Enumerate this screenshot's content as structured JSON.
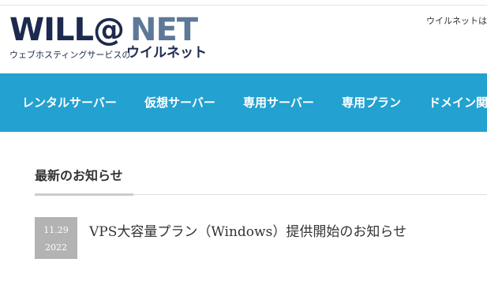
{
  "header": {
    "logo": {
      "part1": "WILL@",
      "part2": "NET",
      "tagline": "ウェブホスティングサービスの",
      "brand": "ウイルネット"
    },
    "note": "ウイルネットは"
  },
  "nav": {
    "items": [
      {
        "label": "レンタルサーバー"
      },
      {
        "label": "仮想サーバー"
      },
      {
        "label": "専用サーバー"
      },
      {
        "label": "専用プラン"
      },
      {
        "label": "ドメイン関"
      }
    ]
  },
  "news": {
    "heading": "最新のお知らせ",
    "items": [
      {
        "month_day": "11.29",
        "year": "2022",
        "title": "VPS大容量プラン（Windows）提供開始のお知らせ"
      }
    ]
  },
  "colors": {
    "nav_background": "#23a1d0",
    "logo_dark": "#1d2a4f",
    "logo_light": "#5e7998",
    "date_box": "#b3b3b3"
  }
}
